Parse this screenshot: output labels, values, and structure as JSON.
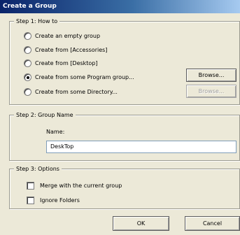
{
  "window": {
    "title": "Create a Group"
  },
  "step1": {
    "legend": "Step 1: How to",
    "options": [
      {
        "label": "Create an empty group",
        "checked": false
      },
      {
        "label": "Create from [Accessories]",
        "checked": false
      },
      {
        "label": "Create from [Desktop]",
        "checked": false
      },
      {
        "label": "Create from some Program group...",
        "checked": true
      },
      {
        "label": "Create from some Directory...",
        "checked": false
      }
    ],
    "browse_program_label": "Browse...",
    "browse_directory_label": "Browse..."
  },
  "step2": {
    "legend": "Step 2: Group Name",
    "name_label": "Name:",
    "name_value": "DeskTop"
  },
  "step3": {
    "legend": "Step 3: Options",
    "merge_label": "Merge with the current group",
    "merge_checked": false,
    "ignore_label": "Ignore Folders",
    "ignore_checked": false
  },
  "footer": {
    "ok_label": "OK",
    "cancel_label": "Cancel"
  }
}
